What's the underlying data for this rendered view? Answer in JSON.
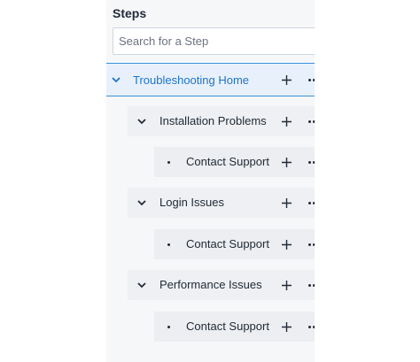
{
  "panel": {
    "title": "Steps",
    "search_placeholder": "Search for a Step"
  },
  "tree": {
    "root": {
      "label": "Troubleshooting Home"
    },
    "groups": [
      {
        "label": "Installation Problems",
        "children": [
          {
            "label": "Contact Support"
          }
        ]
      },
      {
        "label": "Login Issues",
        "children": [
          {
            "label": "Contact Support"
          }
        ]
      },
      {
        "label": "Performance Issues",
        "children": [
          {
            "label": "Contact Support"
          }
        ]
      }
    ]
  },
  "icons": {
    "expand": "chevron-down-icon",
    "add": "plus-icon",
    "more": "more-options-icon",
    "leaf": "bullet-icon"
  },
  "colors": {
    "accent": "#1d73c8",
    "selected_bg": "#e8f1fb",
    "selected_border": "#3b8fdb",
    "panel_bg": "#f6f7f9"
  }
}
